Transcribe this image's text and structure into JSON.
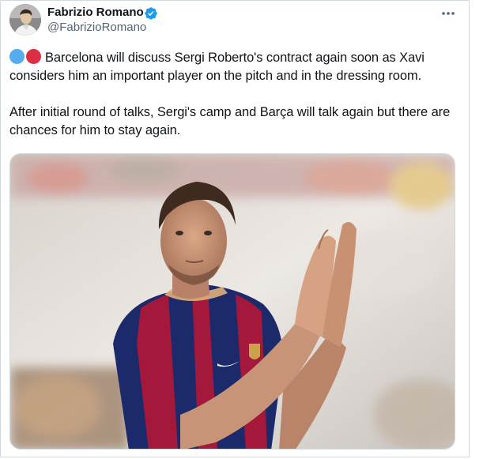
{
  "author": {
    "display_name": "Fabrizio Romano",
    "handle": "@FabrizioRomano",
    "verified_color": "#1d9bf0"
  },
  "icons": {
    "verified": "verified-badge-icon",
    "more": "more-options-icon",
    "emoji_1": "blue-circle-emoji",
    "emoji_2": "red-circle-emoji"
  },
  "tweet": {
    "paragraph_1": "Barcelona will discuss Sergi Roberto's contract again soon as Xavi considers him an important player on the pitch and in the dressing room.",
    "paragraph_2": "After initial round of talks, Sergi's camp and Barça will talk again but there are chances for him to stay again."
  },
  "colors": {
    "text": "#0f1419",
    "secondary_text": "#536471",
    "border": "#cfd9de",
    "emoji_blue": "#55acee",
    "emoji_red": "#dd2e44",
    "kit_blue": "#1c2a6b",
    "kit_red": "#a3183b"
  }
}
